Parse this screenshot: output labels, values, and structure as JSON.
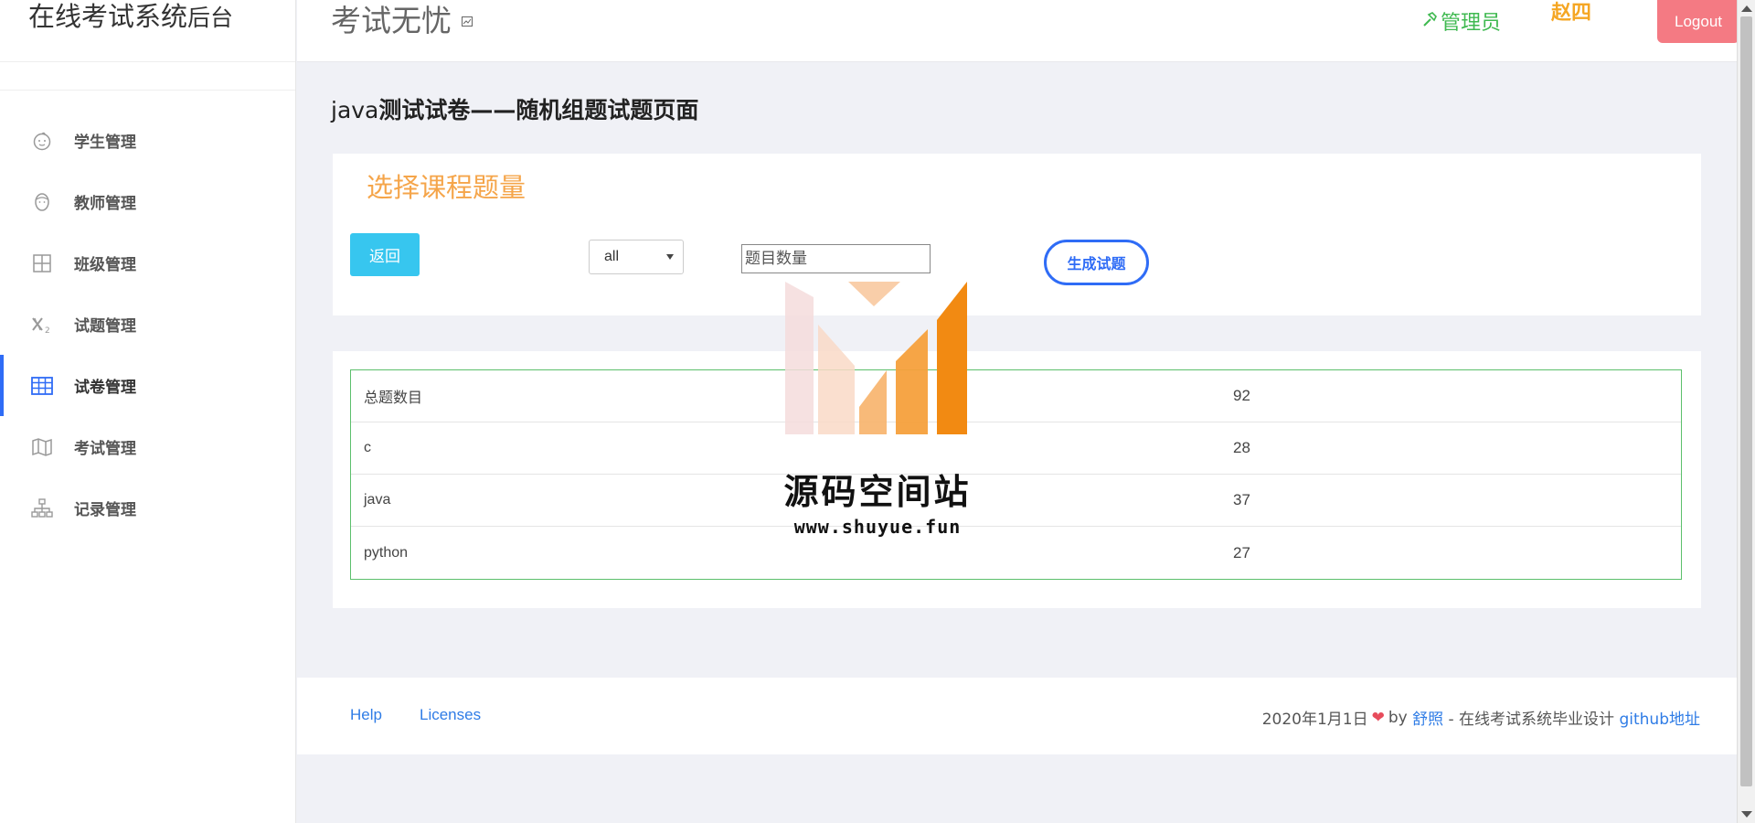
{
  "sidebar": {
    "brand_main": "在线考试系统",
    "brand_suffix": "后台",
    "items": [
      {
        "label": "学生管理",
        "icon": "baby-face-icon",
        "active": false
      },
      {
        "label": "教师管理",
        "icon": "face-icon",
        "active": false
      },
      {
        "label": "班级管理",
        "icon": "grid-icon",
        "active": false
      },
      {
        "label": "试题管理",
        "icon": "x-subscript-icon",
        "active": false
      },
      {
        "label": "试卷管理",
        "icon": "table-icon",
        "active": true
      },
      {
        "label": "考试管理",
        "icon": "map-icon",
        "active": false
      },
      {
        "label": "记录管理",
        "icon": "sitemap-icon",
        "active": false
      }
    ]
  },
  "header": {
    "title": "考试无忧",
    "title_icon": "broken-image-icon",
    "role": "管理员",
    "role_icon": "hammer-icon",
    "username": "赵四",
    "logout_label": "Logout"
  },
  "main": {
    "page_title_en": "java",
    "page_title_cn": "测试试卷——随机组题试题页面",
    "card_title": "选择课程题量",
    "back_label": "返回",
    "course_select_value": "all",
    "qty_placeholder": "题目数量",
    "generate_label": "生成试题",
    "stats": [
      {
        "name": "总题数目",
        "count": "92"
      },
      {
        "name": "c",
        "count": "28"
      },
      {
        "name": "java",
        "count": "37"
      },
      {
        "name": "python",
        "count": "27"
      }
    ]
  },
  "footer": {
    "help": "Help",
    "licenses": "Licenses",
    "date": "2020年1月1日",
    "by": "by",
    "author": "舒照",
    "desc": " - 在线考试系统毕业设计 ",
    "github": "github地址"
  },
  "watermark": {
    "text": "源码空间站",
    "url": "www.shuyue.fun"
  },
  "colors": {
    "accent_blue": "#2f6cf6",
    "orange": "#f5a54a",
    "cyan": "#37c6ef",
    "logout_red": "#f47a83",
    "role_green": "#3fb950",
    "table_border_green": "#5cc06c"
  }
}
